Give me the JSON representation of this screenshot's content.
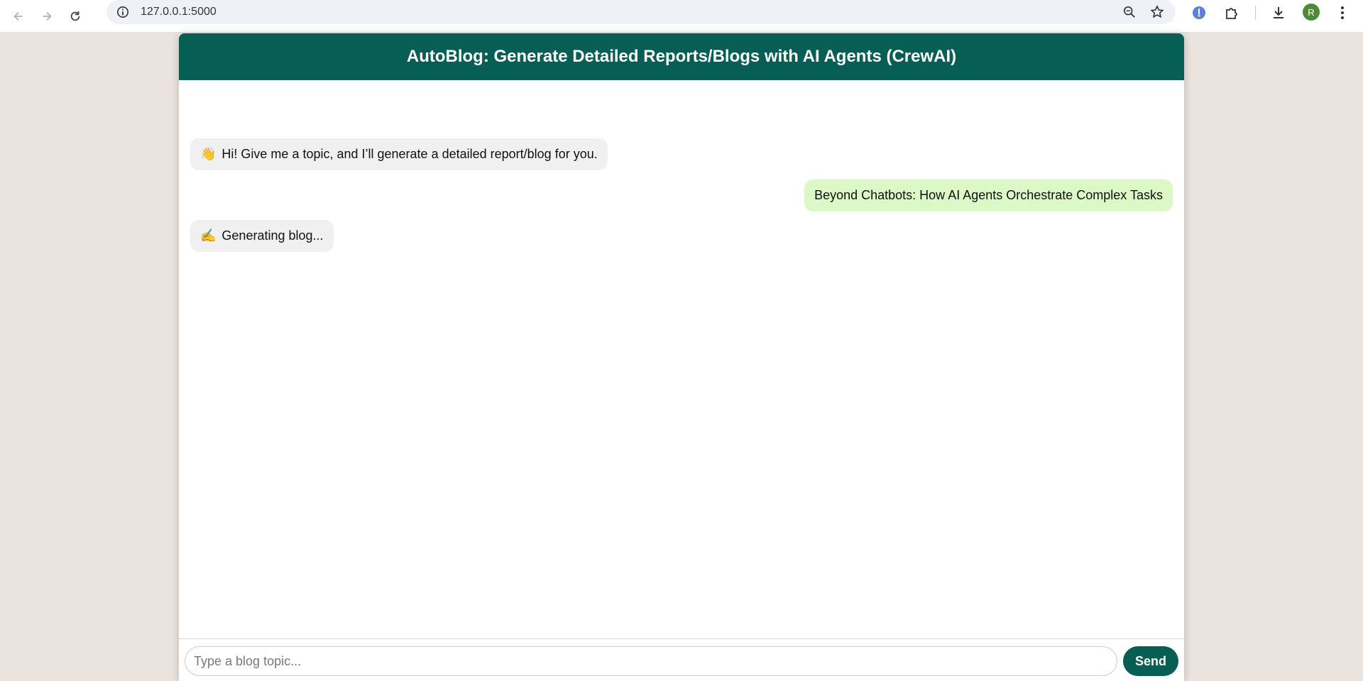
{
  "browser": {
    "url": "127.0.0.1:5000",
    "profile_initial": "R"
  },
  "app": {
    "title": "AutoBlog: Generate Detailed Reports/Blogs with AI Agents (CrewAI)",
    "header_color": "#075e54"
  },
  "messages": [
    {
      "role": "bot",
      "emoji": "👋",
      "text": "Hi! Give me a topic, and I’ll generate a detailed report/blog for you."
    },
    {
      "role": "user",
      "text": "Beyond Chatbots: How AI Agents Orchestrate Complex Tasks"
    },
    {
      "role": "bot",
      "emoji": "✍️",
      "text": "Generating blog..."
    }
  ],
  "input": {
    "placeholder": "Type a blog topic...",
    "value": ""
  },
  "send_label": "Send"
}
